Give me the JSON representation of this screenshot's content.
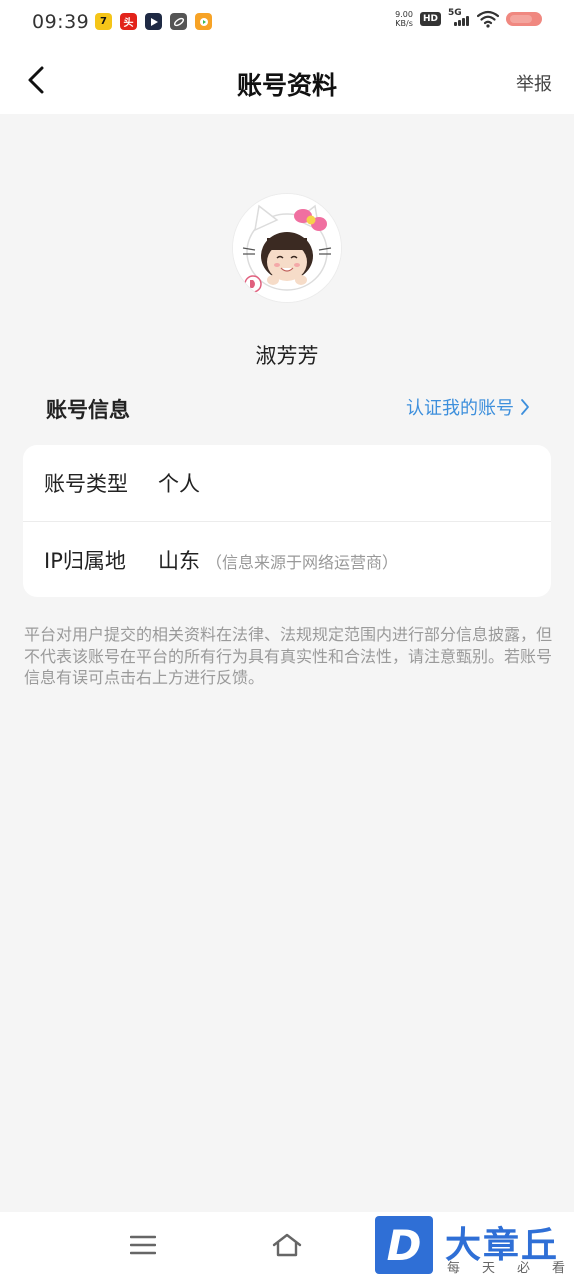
{
  "status_bar": {
    "time": "09:39",
    "net_speed_value": "9.00",
    "net_speed_unit": "KB/s",
    "hd_badge": "HD",
    "signal_label": "5G",
    "app_icons": [
      "app-7-icon",
      "news-app-icon",
      "video-app-icon",
      "link-app-icon",
      "player-app-icon"
    ]
  },
  "nav": {
    "title": "账号资料",
    "report": "举报"
  },
  "profile": {
    "nickname": "淑芳芳"
  },
  "account_section": {
    "title": "账号信息",
    "verify_link": "认证我的账号"
  },
  "info": {
    "rows": [
      {
        "label": "账号类型",
        "value": "个人",
        "note": ""
      },
      {
        "label": "IP归属地",
        "value": "山东",
        "note": "（信息来源于网络运营商）"
      }
    ]
  },
  "disclaimer": "平台对用户提交的相关资料在法律、法规规定范围内进行部分信息披露，但不代表该账号在平台的所有行为具有真实性和合法性，请注意甄别。若账号信息有误可点击右上方进行反馈。",
  "watermark": {
    "letter": "D",
    "title": "大章丘",
    "subtitle": "每天必看"
  },
  "colors": {
    "accent": "#3d8fdc",
    "background": "#f5f5f5",
    "card": "#ffffff",
    "muted_text": "#9a9a9a",
    "watermark_blue": "#2f6fd6"
  }
}
